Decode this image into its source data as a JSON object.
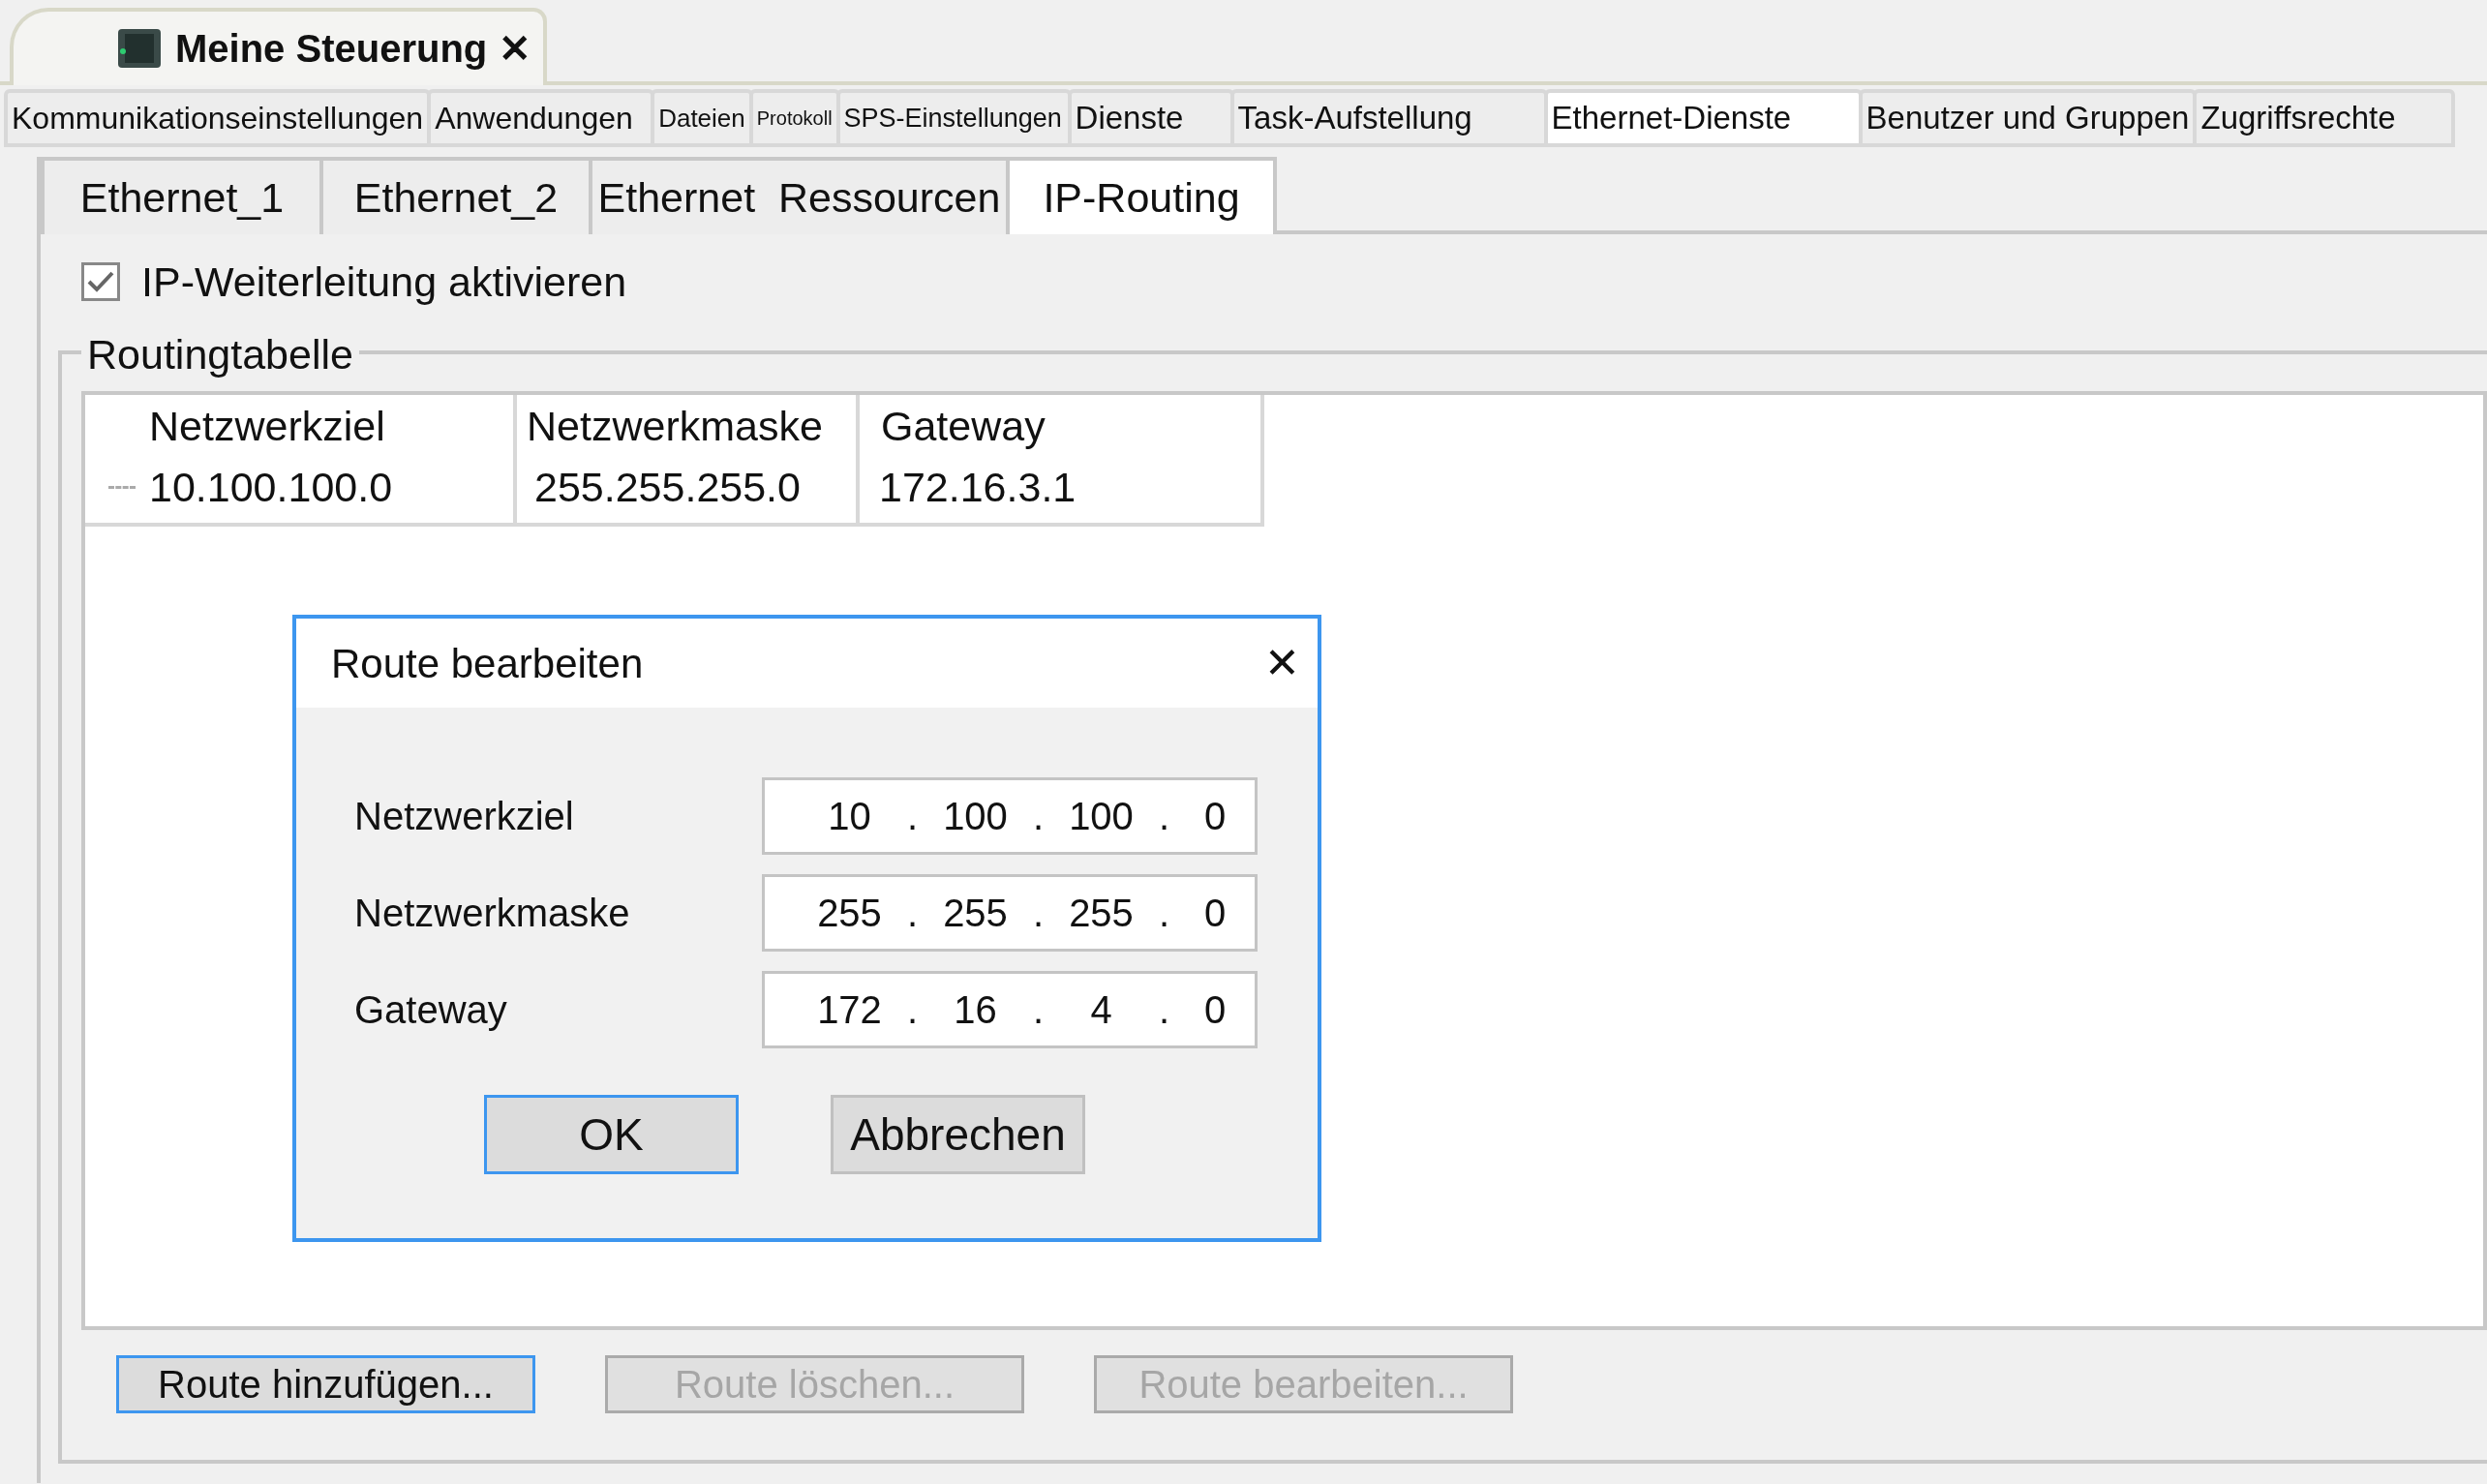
{
  "document_tab": {
    "title": "Meine Steuerung",
    "close": "✕"
  },
  "tabs": [
    {
      "label": "Kommunikationseinstellungen",
      "selected": false
    },
    {
      "label": "Anwendungen",
      "selected": false
    },
    {
      "label": "Dateien",
      "selected": false
    },
    {
      "label": "Protokoll",
      "selected": false
    },
    {
      "label": "SPS-Einstellungen",
      "selected": false
    },
    {
      "label": "Dienste",
      "selected": false
    },
    {
      "label": "Task-Aufstellung",
      "selected": false
    },
    {
      "label": "Ethernet-Dienste",
      "selected": true
    },
    {
      "label": "Benutzer und Gruppen",
      "selected": false
    },
    {
      "label": "Zugriffsrechte",
      "selected": false
    }
  ],
  "subtabs": [
    {
      "label": "Ethernet_1",
      "selected": false
    },
    {
      "label": "Ethernet_2",
      "selected": false
    },
    {
      "label": "Ethernet  Ressourcen",
      "selected": false
    },
    {
      "label": "IP-Routing",
      "selected": true
    }
  ],
  "ip_forwarding": {
    "label": "IP-Weiterleitung aktivieren",
    "checked": true
  },
  "routing_table": {
    "title": "Routingtabelle",
    "columns": [
      "Netzwerkziel",
      "Netzwerkmaske",
      "Gateway"
    ],
    "rows": [
      [
        "10.100.100.0",
        "255.255.255.0",
        "172.16.3.1"
      ]
    ]
  },
  "dialog": {
    "title": "Route bearbeiten",
    "close": "✕",
    "fields": [
      {
        "label": "Netzwerkziel",
        "parts": [
          "10",
          ".",
          "100",
          ".",
          "100",
          ".",
          "0"
        ]
      },
      {
        "label": "Netzwerkmaske",
        "parts": [
          "255",
          ".",
          "255",
          ".",
          "255",
          ".",
          "0"
        ]
      },
      {
        "label": "Gateway",
        "parts": [
          "172",
          ".",
          "16",
          ".",
          "4",
          ".",
          "0"
        ]
      }
    ],
    "buttons": [
      {
        "label": "OK",
        "focused": true
      },
      {
        "label": "Abbrechen",
        "focused": false
      }
    ]
  },
  "buttons": [
    {
      "label": "Route hinzufügen...",
      "disabled": false,
      "focused": true
    },
    {
      "label": "Route löschen...",
      "disabled": true,
      "focused": false
    },
    {
      "label": "Route bearbeiten...",
      "disabled": true,
      "focused": false
    }
  ]
}
